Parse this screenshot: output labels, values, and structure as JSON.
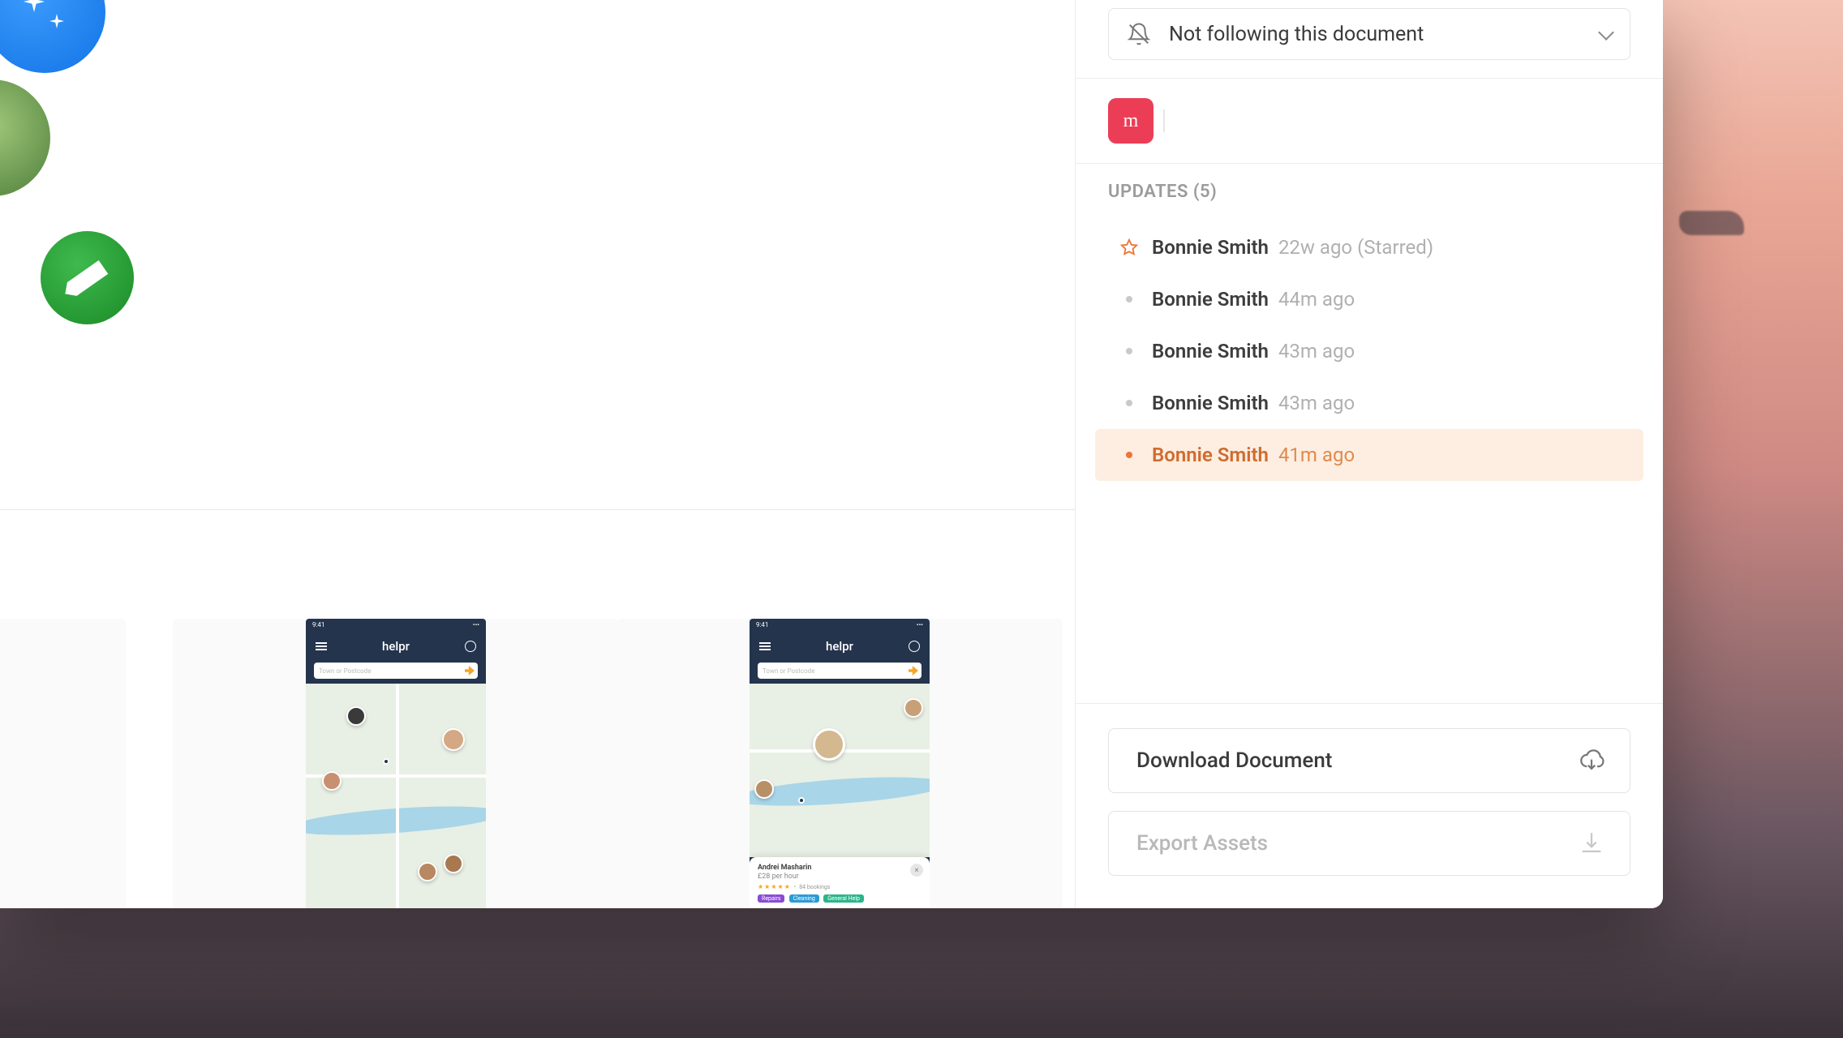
{
  "follow": {
    "label": "Not following this document"
  },
  "app_badge": {
    "letter": "m"
  },
  "updates": {
    "heading": "UPDATES (5)",
    "items": [
      {
        "name": "Bonnie Smith",
        "time": "22w ago (Starred)",
        "starred": true,
        "highlighted": false
      },
      {
        "name": "Bonnie Smith",
        "time": "44m ago",
        "starred": false,
        "highlighted": false
      },
      {
        "name": "Bonnie Smith",
        "time": "43m ago",
        "starred": false,
        "highlighted": false
      },
      {
        "name": "Bonnie Smith",
        "time": "43m ago",
        "starred": false,
        "highlighted": false
      },
      {
        "name": "Bonnie Smith",
        "time": "41m ago",
        "starred": false,
        "highlighted": true
      }
    ]
  },
  "actions": {
    "download": "Download Document",
    "export": "Export Assets"
  },
  "thumbnails": {
    "app_title": "helpr",
    "search_placeholder": "Town or Postcode",
    "status_time": "9:41",
    "card": {
      "name": "Andrei Masharin",
      "rate": "£28 per hour",
      "meta": "84 bookings",
      "tags": [
        "Repairs",
        "Cleaning",
        "General Help"
      ]
    }
  }
}
